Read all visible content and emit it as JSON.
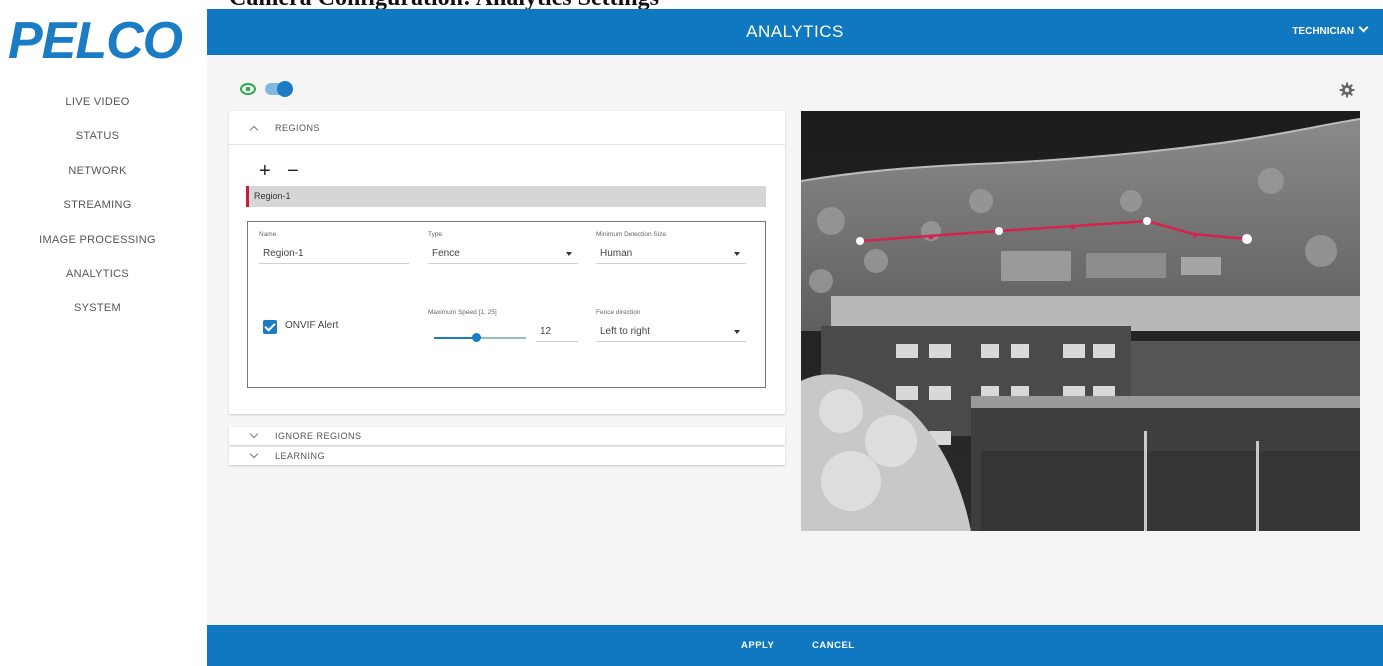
{
  "top_caption": "Camera Configuration: Analytics Settings",
  "brand": {
    "logo_text": "PELCO",
    "logo_color": "#1a7cc4"
  },
  "sidebar": {
    "items": [
      {
        "label": "LIVE VIDEO"
      },
      {
        "label": "STATUS"
      },
      {
        "label": "NETWORK"
      },
      {
        "label": "STREAMING"
      },
      {
        "label": "IMAGE PROCESSING"
      },
      {
        "label": "ANALYTICS"
      },
      {
        "label": "SYSTEM"
      }
    ]
  },
  "header": {
    "title": "ANALYTICS",
    "user": "TECHNICIAN",
    "color": "#0f78c0"
  },
  "toolbar": {
    "visibility_toggle": "on",
    "icons": [
      "eye-icon",
      "gear-icon"
    ]
  },
  "regions_panel": {
    "title": "REGIONS",
    "add_symbol": "+",
    "remove_symbol": "−",
    "selected_region": "Region-1",
    "form": {
      "name_label": "Name",
      "name_value": "Region-1",
      "type_label": "Type",
      "type_value": "Fence",
      "min_size_label": "Minimum Detection Size",
      "min_size_value": "Human",
      "onvif_label": "ONVIF Alert",
      "onvif_checked": true,
      "max_speed_label": "Maximum Speed [1, 25]",
      "max_speed_value": "12",
      "max_speed_fraction": 0.46,
      "fence_dir_label": "Fence direction",
      "fence_dir_value": "Left to right"
    }
  },
  "ignore_panel": {
    "title": "IGNORE REGIONS"
  },
  "learning_panel": {
    "title": "LEARNING"
  },
  "fence_line_color": "#d6224e",
  "footer": {
    "apply": "APPLY",
    "cancel": "CANCEL"
  }
}
